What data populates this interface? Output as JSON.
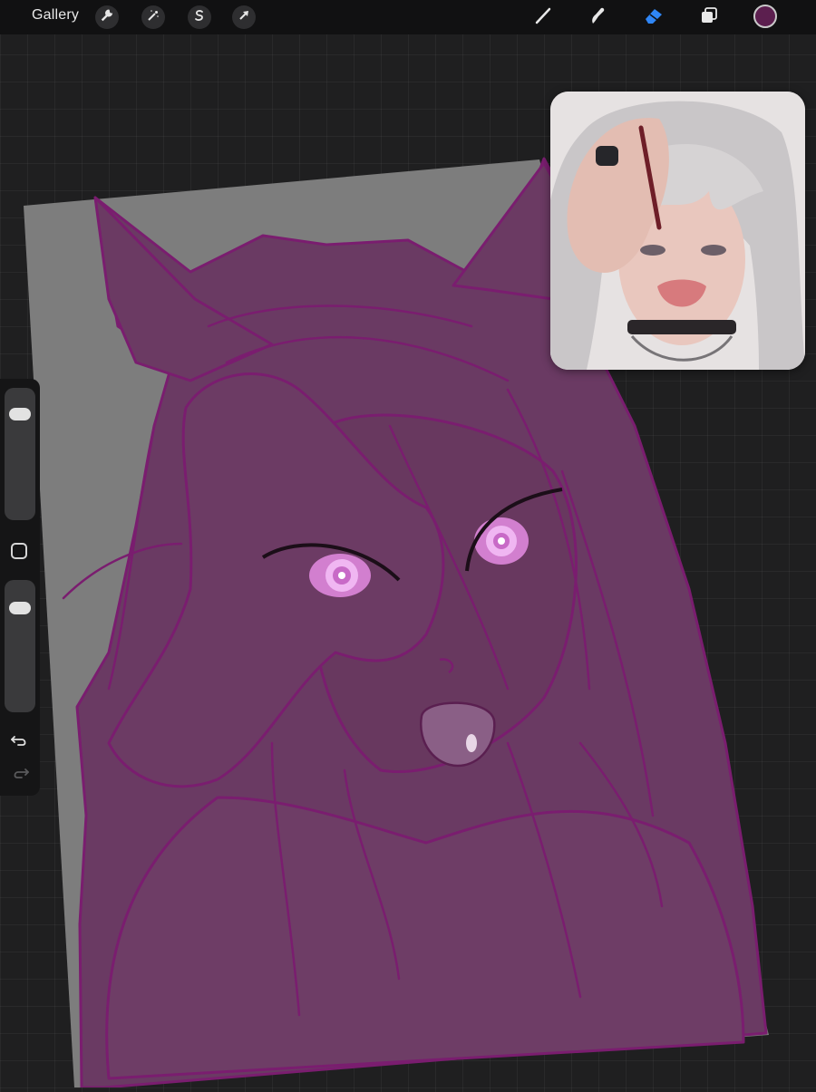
{
  "topbar": {
    "gallery_label": "Gallery",
    "left_tools": [
      {
        "name": "actions",
        "icon": "wrench-icon"
      },
      {
        "name": "adjustments",
        "icon": "magic-wand-icon"
      },
      {
        "name": "selection",
        "icon": "selection-s-icon"
      },
      {
        "name": "transform",
        "icon": "arrow-cursor-icon"
      }
    ],
    "right_tools": [
      {
        "name": "brush",
        "icon": "brush-icon",
        "active": false
      },
      {
        "name": "smudge",
        "icon": "smudge-icon",
        "active": false
      },
      {
        "name": "eraser",
        "icon": "eraser-icon",
        "active": true
      },
      {
        "name": "layers",
        "icon": "layers-icon",
        "active": false
      }
    ],
    "current_color": "#5c1f4f",
    "active_tool_color": "#2f86f6"
  },
  "sidebar": {
    "brush_size": 0.13,
    "opacity": 0.85,
    "icons": [
      "modify-square-icon",
      "undo-icon",
      "redo-icon"
    ]
  },
  "canvas": {
    "background": "#7d7d7d",
    "fill_color": "#6a3a63",
    "line_color": "#7a1d6f",
    "eye_glow": "#e9a6ee"
  },
  "reference": {
    "background": "#e8e4e4",
    "hair": "#c9c6c8"
  }
}
